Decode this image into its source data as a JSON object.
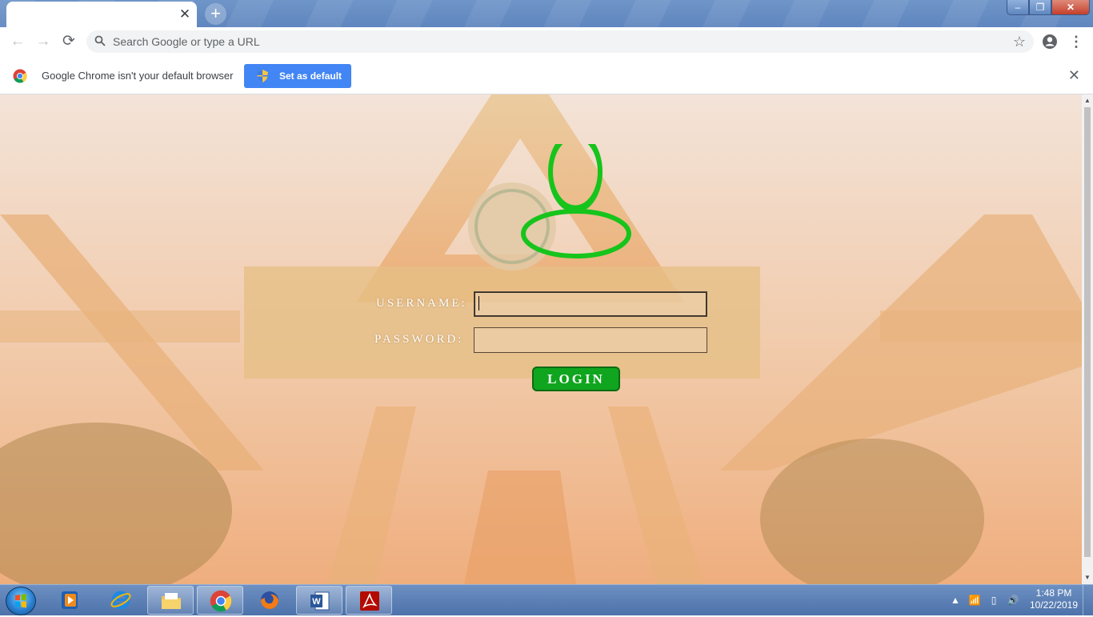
{
  "browser": {
    "tab": {
      "title": "",
      "close_label": "✕"
    },
    "new_tab_label": "+",
    "window_controls": {
      "minimize": "‒",
      "maximize": "❐",
      "close": "✕"
    },
    "toolbar": {
      "back_label": "←",
      "forward_label": "→",
      "reload_label": "⟳",
      "omnibox_placeholder": "Search Google or type a URL",
      "omnibox_value": "",
      "star_label": "☆",
      "menu_label": "⋮"
    },
    "infobar": {
      "message": "Google Chrome isn't your default browser",
      "button_label": "Set as default",
      "close_label": "✕"
    }
  },
  "login": {
    "username_label": "USERNAME:",
    "password_label": "PASSWORD:",
    "username_value": "",
    "password_value": "",
    "login_button": "LOGIN",
    "accent_color": "#17c41c"
  },
  "taskbar": {
    "items": [
      {
        "name": "windows-media-player-icon",
        "active": false
      },
      {
        "name": "internet-explorer-icon",
        "active": false
      },
      {
        "name": "file-explorer-icon",
        "active": true
      },
      {
        "name": "chrome-icon",
        "active": true
      },
      {
        "name": "firefox-icon",
        "active": false
      },
      {
        "name": "word-icon",
        "active": true
      },
      {
        "name": "acrobat-icon",
        "active": true
      }
    ],
    "tray": {
      "show_hidden": "▲",
      "network": "📶",
      "battery": "▯",
      "volume": "🔊"
    },
    "clock": {
      "time": "1:48 PM",
      "date": "10/22/2019"
    }
  }
}
